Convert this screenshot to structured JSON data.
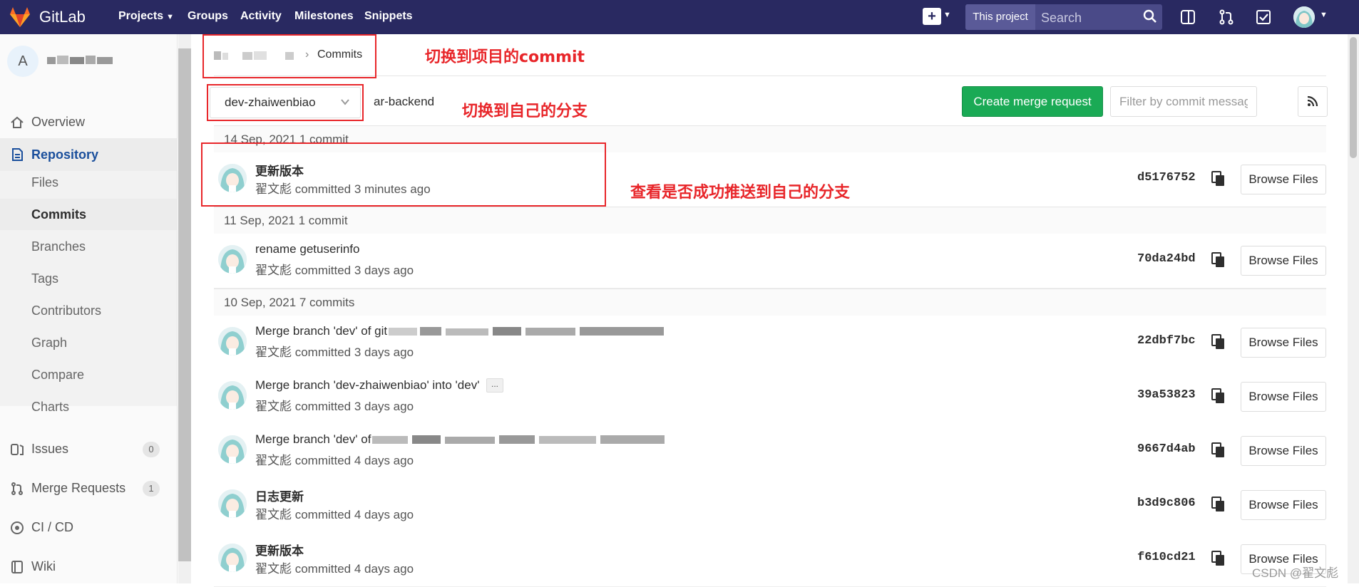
{
  "navbar": {
    "brand": "GitLab",
    "links": [
      {
        "label": "Projects",
        "has_caret": true
      },
      {
        "label": "Groups"
      },
      {
        "label": "Activity"
      },
      {
        "label": "Milestones"
      },
      {
        "label": "Snippets"
      }
    ],
    "search_scope": "This project",
    "search_placeholder": "Search",
    "icons": [
      "plus-icon",
      "search-icon",
      "sidebar-toggle-icon",
      "merge-request-icon",
      "todo-check-icon",
      "user-avatar"
    ]
  },
  "sidebar": {
    "project_initial": "A",
    "items": [
      {
        "label": "Overview",
        "icon": "home-icon"
      },
      {
        "label": "Repository",
        "icon": "repository-icon",
        "active": true
      },
      {
        "label": "Files"
      },
      {
        "label": "Commits",
        "active": true
      },
      {
        "label": "Branches"
      },
      {
        "label": "Tags"
      },
      {
        "label": "Contributors"
      },
      {
        "label": "Graph"
      },
      {
        "label": "Compare"
      },
      {
        "label": "Charts"
      },
      {
        "label": "Issues",
        "icon": "issues-icon",
        "count": "0"
      },
      {
        "label": "Merge Requests",
        "icon": "merge-request-icon",
        "count": "1"
      },
      {
        "label": "CI / CD",
        "icon": "ci-cd-icon"
      },
      {
        "label": "Wiki",
        "icon": "wiki-icon"
      }
    ]
  },
  "breadcrumb": {
    "current": "Commits"
  },
  "toolbar": {
    "branch": "dev-zhaiwenbiao",
    "repo_path": "ar-backend",
    "create_mr_label": "Create merge request",
    "filter_placeholder": "Filter by commit message"
  },
  "days": [
    {
      "header": "14 Sep, 2021 1 commit"
    },
    {
      "header": "11 Sep, 2021 1 commit"
    },
    {
      "header": "10 Sep, 2021 7 commits"
    }
  ],
  "commits": [
    {
      "title": "更新版本",
      "meta": "翟文彪 committed 3 minutes ago",
      "sha": "d5176752",
      "browse": "Browse Files"
    },
    {
      "title": "rename getuserinfo",
      "meta": "翟文彪 committed 3 days ago",
      "sha": "70da24bd",
      "browse": "Browse Files"
    },
    {
      "title": "Merge branch 'dev' of git",
      "meta": "翟文彪 committed 3 days ago",
      "sha": "22dbf7bc",
      "browse": "Browse Files"
    },
    {
      "title": "Merge branch 'dev-zhaiwenbiao' into 'dev'",
      "more": "...",
      "meta": "翟文彪 committed 3 days ago",
      "sha": "39a53823",
      "browse": "Browse Files"
    },
    {
      "title": "Merge branch 'dev' of",
      "meta": "翟文彪 committed 4 days ago",
      "sha": "9667d4ab",
      "browse": "Browse Files"
    },
    {
      "title": "日志更新",
      "meta": "翟文彪 committed 4 days ago",
      "sha": "b3d9c806",
      "browse": "Browse Files"
    },
    {
      "title": "更新版本",
      "meta": "翟文彪 committed 4 days ago",
      "sha": "f610cd21",
      "browse": "Browse Files"
    }
  ],
  "annotations": {
    "commit_hint": "切换到项目的commit",
    "branch_hint": "切换到自己的分支",
    "push_hint": "查看是否成功推送到自己的分支"
  },
  "watermark": "CSDN @翟文彪",
  "colors": {
    "navbar": "#292961",
    "merge_button": "#1aaa55",
    "annotation": "#e8262a",
    "repository_active": "#1a4f9c"
  }
}
